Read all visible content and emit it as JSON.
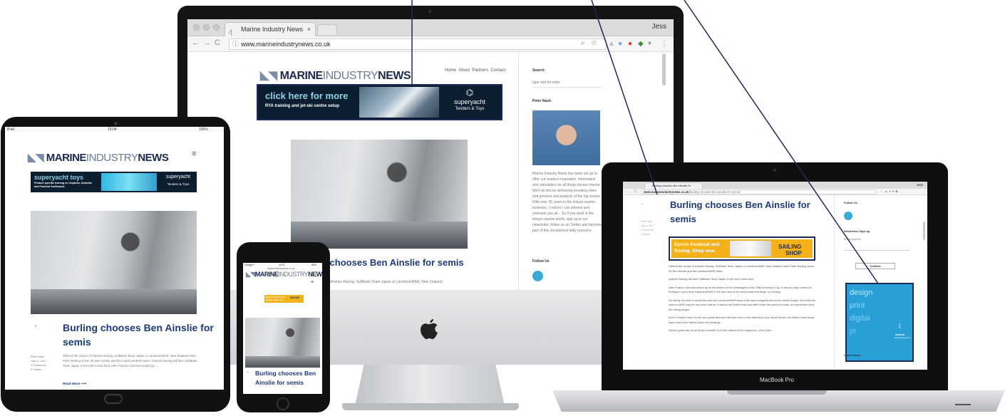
{
  "site": {
    "logo_bold": "MARINE",
    "logo_thin": "INDUSTRY",
    "logo_tail": "NEWS",
    "nav": [
      "Home",
      "About",
      "Partners",
      "Contact"
    ]
  },
  "article": {
    "title": "Burling chooses Ben Ainslie for semis",
    "title_line1": "Burling chooses Ben Ainslie for",
    "title_line2": "semis",
    "phone_line1": "Burling chooses Ben",
    "phone_line2": "Ainslie for semis",
    "imac_title_visible": "g chooses Ben Ainslie for semis",
    "imac_body_visible": "ce of Artemis Racing, SoftBank Team Japan or LandroverBAR, New Zealand",
    "author": "Peter Nash",
    "date": "June 4, 2017",
    "comments": "0 Comments",
    "shares": "0 Shares",
    "excerpt": "Offered the choice of Artemis Racing, SoftBank Team Japan or LandroverBAR, New Zealand helm Peter Burling chose Sir Ben Ainslie and the LandroverBAR team. Artemis Racing will face SoftBank Team Japan in the toher semi-final. After Franck Cammas ended up ....",
    "read_more": "Read More ⟶",
    "paragraphs": [
      "Offered the choice of Artemis Racing, SoftBank Team Japan or LandroverBAR, New Zealand helm Peter Burling chose Sir Ben Ainslie and the LandroverBAR team.",
      "Artemis Racing will face SoftBank Team Japan in the toher semi-final.",
      "After Franck Cammas ended up at the bottom of the challengers in the 35th America's Cup, it was an easy choice for Burling to opt to face LandroverBAR in the first race of the semi-finals that begin on Sunday.",
      "It's hardly the kind of result Ben and his LandroverBAR team must have imagined before the series began. But while the crew on BAR may be top notch sailors, it seems the British boat just didn't have the speed to make an impression once the racing began.",
      "And if it hadn't been for the two points Ben and the team won in the America's Cup World Series, the British boat would have been even further down the rankings.",
      "What a great pity for all those involved, from the sailors to the engineers. Let's hope..."
    ]
  },
  "imac": {
    "tab_title": "Marine Industry News",
    "url": "www.marineindustrynews.co.uk",
    "user": "Jess",
    "search_label": "Search",
    "search_placeholder": "type and hit enter",
    "author_label": "Peter Nash",
    "bio": "Marine Industry News has been set up to offer our readers inspiration, information and stimulation on all things leisure marine. We'll do this by delivering breaking news and pictures and analysis of the big stories. With over 35 years in the leisure marine business, I reckon I can interest and entertain you all... So if you work in the leisure marine world, sign up to our newsletter, follow us on Twitter and become part of this exceptional daily resource.",
    "follow_label": "Follow Us"
  },
  "ad_imac": {
    "cta": "click here for more",
    "sub": "RYA training and jet-ski centre setup",
    "brand_top": "superyacht",
    "brand_bottom": "Tenders & Toys"
  },
  "ad_ipad": {
    "cta": "superyacht toys",
    "sub": "Product specific training on Jetpacks, Seabobs and Powered Surfboards",
    "brand_top": "superyacht",
    "brand_bottom": "Tenders & Toys"
  },
  "ipad": {
    "status_left": "iPad",
    "status_time": "16:04",
    "status_right": "100%"
  },
  "iphone": {
    "status_left": "Orange F",
    "status_time": "16:02",
    "status_right": "56%",
    "url": "marineindustrynews.co.uk"
  },
  "macbook": {
    "tab_title": "Burling chooses Ben Ainslie fo",
    "url_host": "www.marineindustrynews.co.uk",
    "url_path": "/burling-chooses-ben-ainslie-for-semis/",
    "user": "Jess",
    "label": "MacBook Pro",
    "follow_label": "Follow Us",
    "newsletter_label": "Newsletter Sign-up",
    "email_placeholder": "Email Address",
    "confirm_label": "Confirm",
    "latest_label": "Latest News",
    "sailing_ad": {
      "line1": "Sports Keelboat and",
      "line2": "Racing. Shop now.",
      "brand_top": "SAILING",
      "brand_bottom": "SHOP"
    },
    "design_ad": {
      "words": [
        "design",
        "print",
        "digital",
        "pr"
      ],
      "brand": "marine",
      "brand_sub": "advertising agency"
    }
  },
  "colors": {
    "brand_navy": "#1e2a5a",
    "title_blue": "#1e3a78",
    "social_blue": "#3aa9d6",
    "ad_navy": "#0b1d2e",
    "ad_cyan": "#8fd3e6",
    "sailing_yellow": "#f3b11a",
    "design_blue": "#2a9fd6"
  },
  "icons": [
    "apple-logo-icon",
    "share-icon",
    "twitter-icon",
    "hamburger-menu-icon",
    "lock-info-icon",
    "star-icon",
    "search-icon"
  ]
}
